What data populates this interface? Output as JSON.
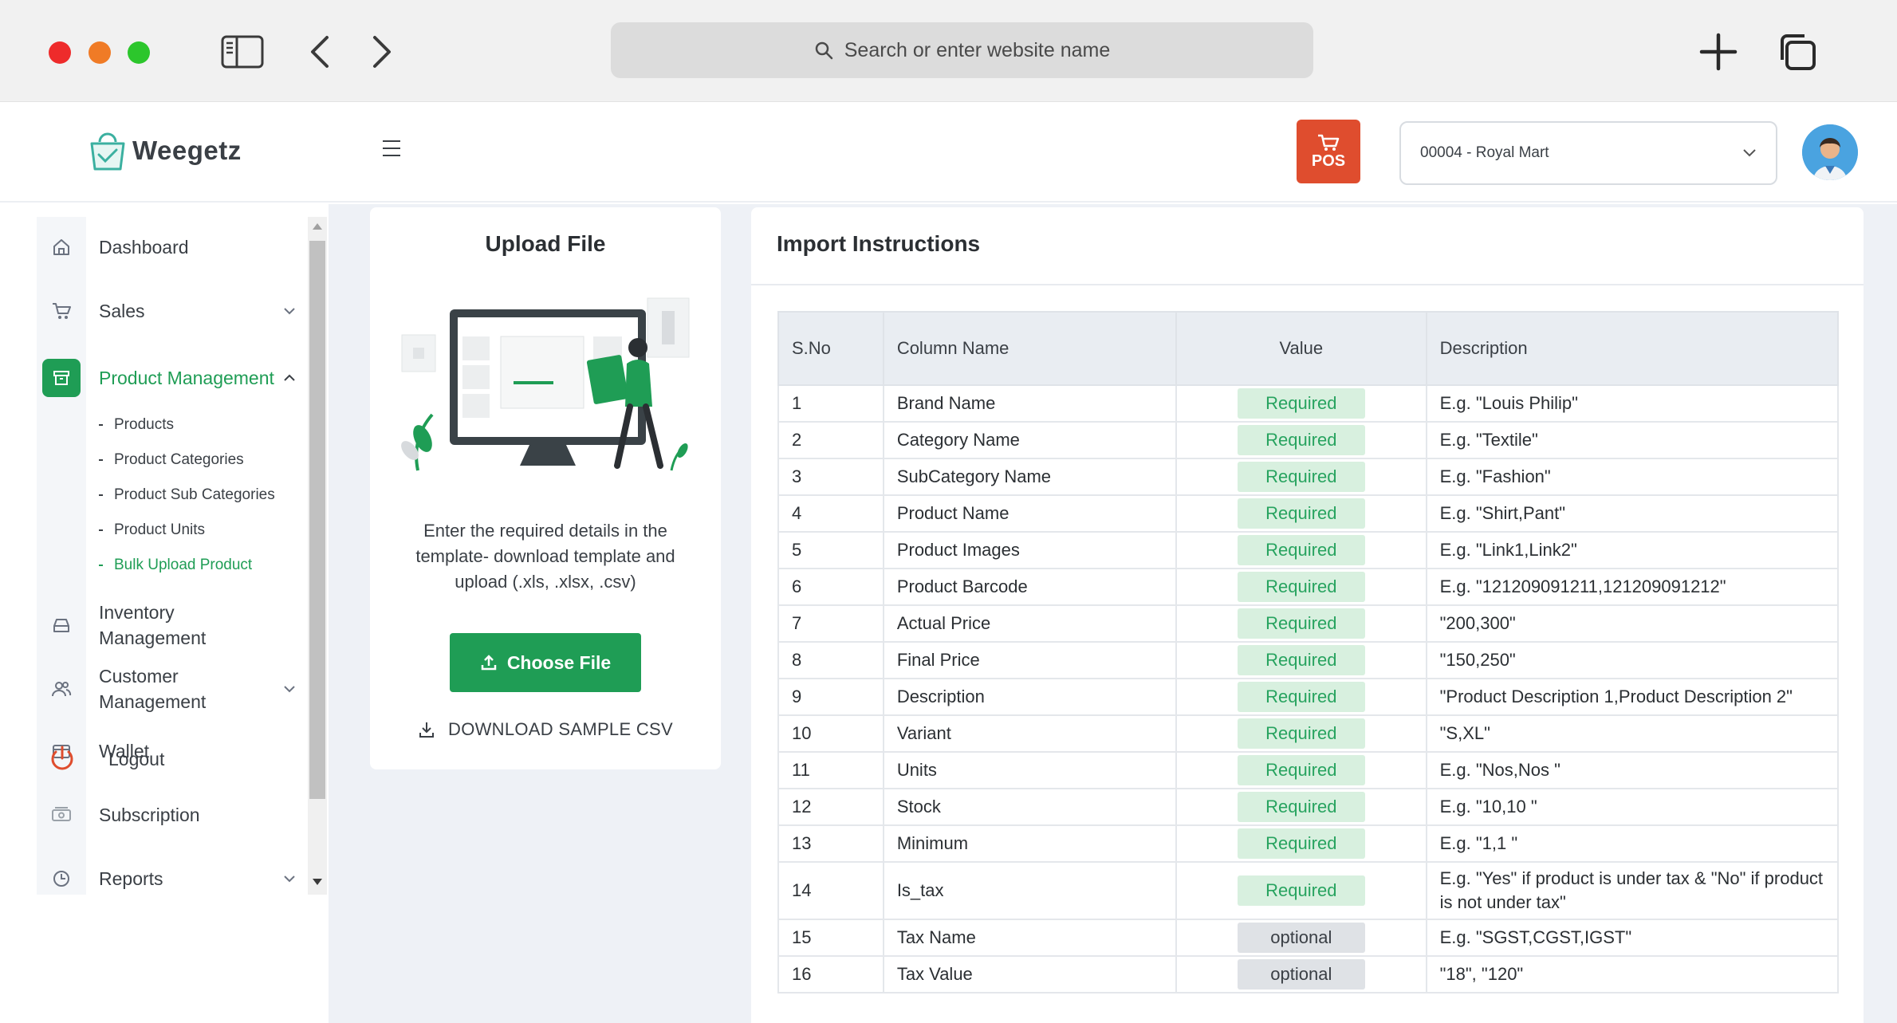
{
  "browser": {
    "search_placeholder": "Search or enter website name"
  },
  "header": {
    "brand": "Weegetz",
    "pos_label": "POS",
    "store_selected": "00004 - Royal Mart"
  },
  "sidebar": {
    "items": [
      {
        "label": "Dashboard",
        "icon": "home-icon"
      },
      {
        "label": "Sales",
        "icon": "cart-icon"
      },
      {
        "label": "Product Management",
        "icon": "archive-icon"
      },
      {
        "label": "Inventory Management",
        "icon": "inbox-icon"
      },
      {
        "label": "Customer Management",
        "icon": "users-icon"
      },
      {
        "label": "Wallet",
        "icon": "wallet-icon"
      },
      {
        "label": "Subscription",
        "icon": "subscription-icon"
      },
      {
        "label": "Reports",
        "icon": "clock-icon"
      }
    ],
    "sub_items": [
      "Products",
      "Product Categories",
      "Product Sub Categories",
      "Product Units",
      "Bulk Upload Product"
    ],
    "logout": "Logout"
  },
  "upload": {
    "title": "Upload File",
    "description": "Enter the required details in the template- download template and upload (.xls, .xlsx, .csv)",
    "choose_button": "Choose File",
    "download_link": "DOWNLOAD SAMPLE CSV"
  },
  "instructions": {
    "title": "Import Instructions",
    "columns": [
      "S.No",
      "Column Name",
      "Value",
      "Description"
    ],
    "rows": [
      {
        "sno": "1",
        "name": "Brand Name",
        "value": "Required",
        "desc": "E.g. \"Louis Philip\""
      },
      {
        "sno": "2",
        "name": "Category Name",
        "value": "Required",
        "desc": "E.g. \"Textile\""
      },
      {
        "sno": "3",
        "name": "SubCategory Name",
        "value": "Required",
        "desc": "E.g. \"Fashion\""
      },
      {
        "sno": "4",
        "name": "Product Name",
        "value": "Required",
        "desc": "E.g. \"Shirt,Pant\""
      },
      {
        "sno": "5",
        "name": "Product Images",
        "value": "Required",
        "desc": "E.g. \"Link1,Link2\""
      },
      {
        "sno": "6",
        "name": "Product Barcode",
        "value": "Required",
        "desc": "E.g. \"121209091211,121209091212\""
      },
      {
        "sno": "7",
        "name": "Actual Price",
        "value": "Required",
        "desc": "\"200,300\""
      },
      {
        "sno": "8",
        "name": "Final Price",
        "value": "Required",
        "desc": "\"150,250\""
      },
      {
        "sno": "9",
        "name": "Description",
        "value": "Required",
        "desc": "\"Product Description 1,Product Description 2\""
      },
      {
        "sno": "10",
        "name": "Variant",
        "value": "Required",
        "desc": "\"S,XL\""
      },
      {
        "sno": "11",
        "name": "Units",
        "value": "Required",
        "desc": "E.g. \"Nos,Nos \""
      },
      {
        "sno": "12",
        "name": "Stock",
        "value": "Required",
        "desc": "E.g. \"10,10 \""
      },
      {
        "sno": "13",
        "name": "Minimum",
        "value": "Required",
        "desc": "E.g. \"1,1 \""
      },
      {
        "sno": "14",
        "name": "Is_tax",
        "value": "Required",
        "desc": "E.g. \"Yes\" if product is under tax & \"No\" if product is not under tax\""
      },
      {
        "sno": "15",
        "name": "Tax Name",
        "value": "optional",
        "desc": "E.g. \"SGST,CGST,IGST\""
      },
      {
        "sno": "16",
        "name": "Tax Value",
        "value": "optional",
        "desc": "\"18\", \"120\""
      }
    ]
  },
  "colors": {
    "accent_green": "#1f9d55",
    "pos_orange": "#df4d2e",
    "required_bg": "#d8f0df",
    "optional_bg": "#dfe2e6"
  }
}
